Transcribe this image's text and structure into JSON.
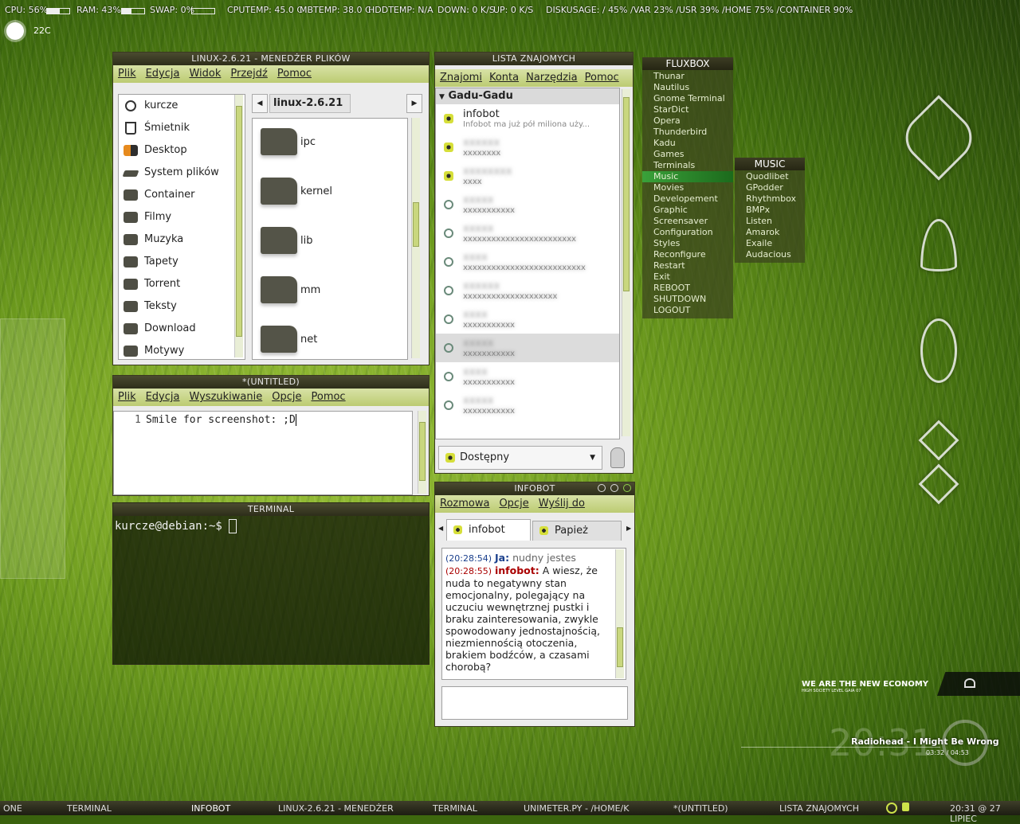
{
  "conky": {
    "cpu": "CPU: 56%",
    "cpu_pct": 56,
    "ram": "RAM: 43%",
    "ram_pct": 43,
    "swap": "SWAP: 0%",
    "swap_pct": 0,
    "cputemp": "CPUTEMP: 45.0 C",
    "mbtemp": "MBTEMP: 38.0 C",
    "hddtemp": "HDDTEMP: N/A",
    "down": "DOWN: 0 K/S",
    "up": "UP: 0 K/S",
    "disk": "DISKUSAGE:   / 45%   /VAR 23%   /USR 39%   /HOME 75%   /CONTAINER 90%"
  },
  "weather": {
    "temp": "22C"
  },
  "filemanager": {
    "title": "LINUX-2.6.21 - MENEDŻER PLIKÓW",
    "menu": [
      "Plik",
      "Edycja",
      "Widok",
      "Przejdź",
      "Pomoc"
    ],
    "path": "linux-2.6.21",
    "places": [
      "kurcze",
      "Śmietnik",
      "Desktop",
      "System plików",
      "Container",
      "Filmy",
      "Muzyka",
      "Tapety",
      "Torrent",
      "Teksty",
      "Download",
      "Motywy"
    ],
    "folders": [
      "ipc",
      "kernel",
      "lib",
      "mm",
      "net"
    ]
  },
  "editor": {
    "title": "*(UNTITLED)",
    "menu": [
      "Plik",
      "Edycja",
      "Wyszukiwanie",
      "Opcje",
      "Pomoc"
    ],
    "line_no": "1",
    "text": "Smile for screenshot: ;D"
  },
  "terminal": {
    "title": "TERMINAL",
    "prompt": "kurcze@debian:~$"
  },
  "contacts": {
    "title": "LISTA ZNAJOMYCH",
    "menu": [
      "Znajomi",
      "Konta",
      "Narzędzia",
      "Pomoc"
    ],
    "group": "Gadu-Gadu",
    "first": {
      "name": "infobot",
      "status": "Infobot ma już pół miliona uży..."
    },
    "status_select": "Dostępny"
  },
  "fluxbox": {
    "title": "FLUXBOX",
    "items": [
      "Thunar",
      "Nautilus",
      "Gnome Terminal",
      "StarDict",
      "Opera",
      "Thunderbird",
      "Kadu",
      "Games",
      "Terminals",
      "Music",
      "Movies",
      "Developement",
      "Graphic",
      "Screensaver",
      "Configuration",
      "Styles",
      "Reconfigure",
      "Restart",
      "Exit",
      "REBOOT",
      "SHUTDOWN",
      "LOGOUT"
    ],
    "music_title": "MUSIC",
    "music_items": [
      "Quodlibet",
      "GPodder",
      "Rhythmbox",
      "BMPx",
      "Listen",
      "Amarok",
      "Exaile",
      "Audacious"
    ]
  },
  "chat": {
    "title": "INFOBOT",
    "menu": [
      "Rozmowa",
      "Opcje",
      "Wyślij do"
    ],
    "tabs": [
      "infobot",
      "Papież"
    ],
    "msg1_time": "(20:28:54)",
    "msg1_who": "Ja:",
    "msg1_text": "nudny jestes",
    "msg2_time": "(20:28:55)",
    "msg2_who": "infobot:",
    "msg2_text": "A wiesz, że nuda to negatywny stan emocjonalny, polegający na uczuciu wewnętrznej pustki i braku zainteresowania, zwykle spowodowany jednostajnością, niezmiennością otoczenia, brakiem bodźców, a czasami chorobą?"
  },
  "wallpaper": {
    "slogan": "WE ARE THE NEW ECONOMY",
    "slogan_sub": "HIGH SOCIETY LEVEL GAIA 07"
  },
  "player": {
    "clock": "20:31",
    "track": "Radiohead - I Might Be Wrong",
    "time": "03:32 / 04:53"
  },
  "taskbar": {
    "items": [
      "ONE",
      "TERMINAL",
      "INFOBOT",
      "LINUX-2.6.21 - MENEDŻER",
      "TERMINAL",
      "UNIMETER.PY - /HOME/K",
      "*(UNTITLED)",
      "LISTA ZNAJOMYCH"
    ],
    "clock": "20:31 @ 27 LIPIEC"
  }
}
